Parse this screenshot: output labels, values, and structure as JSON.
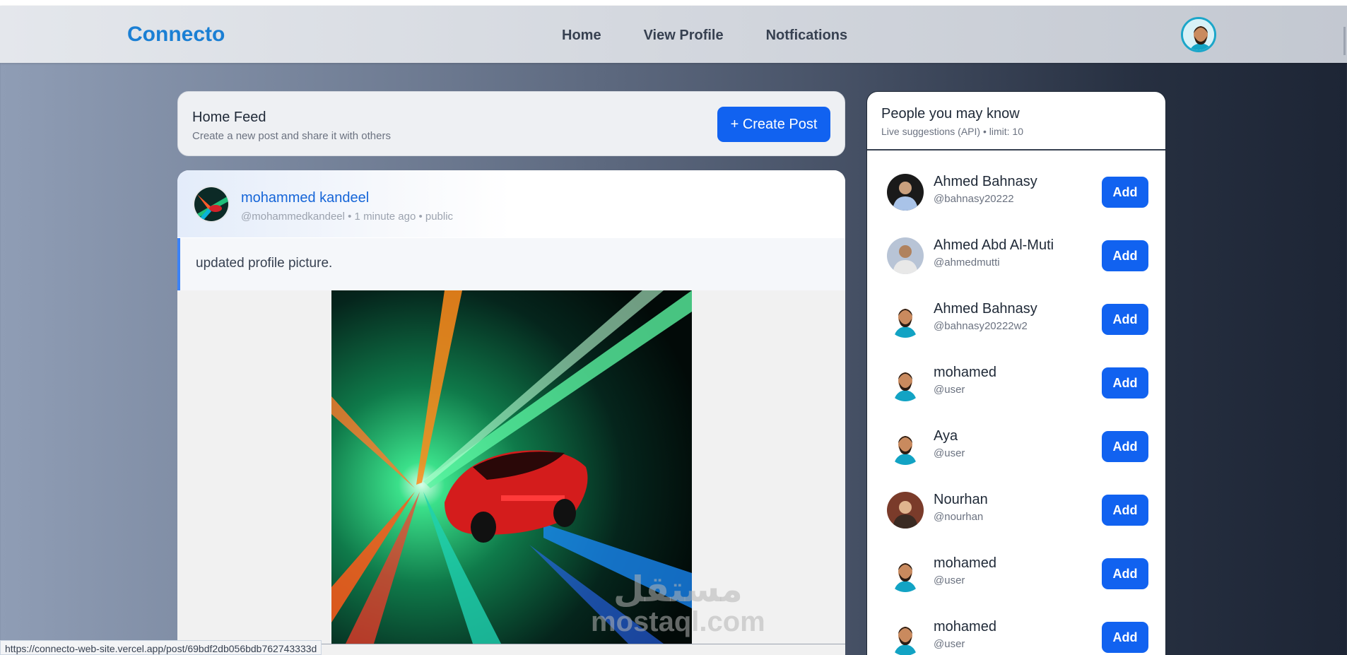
{
  "navbar": {
    "brand": "Connecto",
    "links": [
      "Home",
      "View Profile",
      "Notfications"
    ]
  },
  "feed": {
    "title": "Home Feed",
    "subtitle": "Create a new post and share it with others",
    "create_button": "+ Create Post"
  },
  "post": {
    "author": "mohammed kandeel",
    "meta": "@mohammedkandeel • 1 minute ago • public",
    "text": "updated profile picture."
  },
  "suggestions": {
    "title": "People you may know",
    "subtitle": "Live suggestions (API) • limit: 10",
    "add_label": "Add",
    "items": [
      {
        "name": "Ahmed Bahnasy",
        "handle": "@bahnasy20222"
      },
      {
        "name": "Ahmed Abd Al-Muti",
        "handle": "@ahmedmutti"
      },
      {
        "name": "Ahmed Bahnasy",
        "handle": "@bahnasy20222w2"
      },
      {
        "name": "mohamed",
        "handle": "@user"
      },
      {
        "name": "Aya",
        "handle": "@user"
      },
      {
        "name": "Nourhan",
        "handle": "@nourhan"
      },
      {
        "name": "mohamed",
        "handle": "@user"
      },
      {
        "name": "mohamed",
        "handle": "@user"
      }
    ]
  },
  "status_url": "https://connecto-web-site.vercel.app/post/69bdf2db056bdb762743333d",
  "watermark": {
    "arabic": "مستقل",
    "latin": "mostaql.com"
  },
  "colors": {
    "accent": "#1162f0",
    "brand": "#1a7fd4"
  }
}
